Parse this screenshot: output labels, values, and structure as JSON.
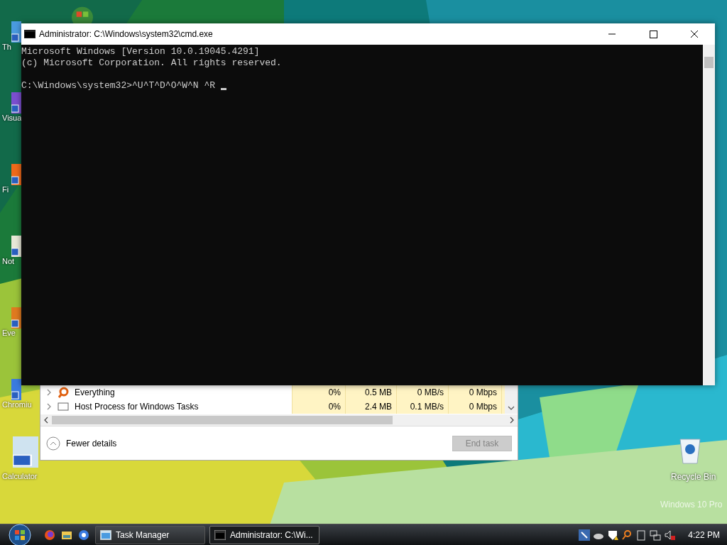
{
  "desktop": {
    "icons": [
      {
        "label": "Th"
      },
      {
        "label": "Visua"
      },
      {
        "label": "Fi"
      },
      {
        "label": "Not"
      },
      {
        "label": "Eve"
      },
      {
        "label": "Chromiu"
      },
      {
        "label": "Calculator"
      }
    ],
    "recycle_bin": {
      "label": "Recycle Bin"
    },
    "watermark": "Windows 10 Pro"
  },
  "console_window": {
    "title": "Administrator: C:\\Windows\\system32\\cmd.exe",
    "lines": [
      {
        "text": "Microsoft Windows [Version 10.0.19045.4291]"
      },
      {
        "text": "(c) Microsoft Corporation. All rights reserved."
      }
    ],
    "prompt": "C:\\Windows\\system32>^U^T^D^O^W^N ^R"
  },
  "task_manager": {
    "rows": [
      {
        "name": "Everything",
        "cpu": "0%",
        "memory": "0.5 MB",
        "disk": "0 MB/s",
        "network": "0 Mbps"
      },
      {
        "name": "Host Process for Windows Tasks",
        "cpu": "0%",
        "memory": "2.4 MB",
        "disk": "0.1 MB/s",
        "network": "0 Mbps"
      }
    ],
    "details_toggle": "Fewer details",
    "end_task": {
      "label": "End task",
      "disabled": true
    }
  },
  "taskbar": {
    "buttons": [
      {
        "label": "Task Manager",
        "selected": false
      },
      {
        "label": "Administrator: C:\\Wi...",
        "selected": true
      }
    ],
    "clock": "4:22 PM"
  }
}
